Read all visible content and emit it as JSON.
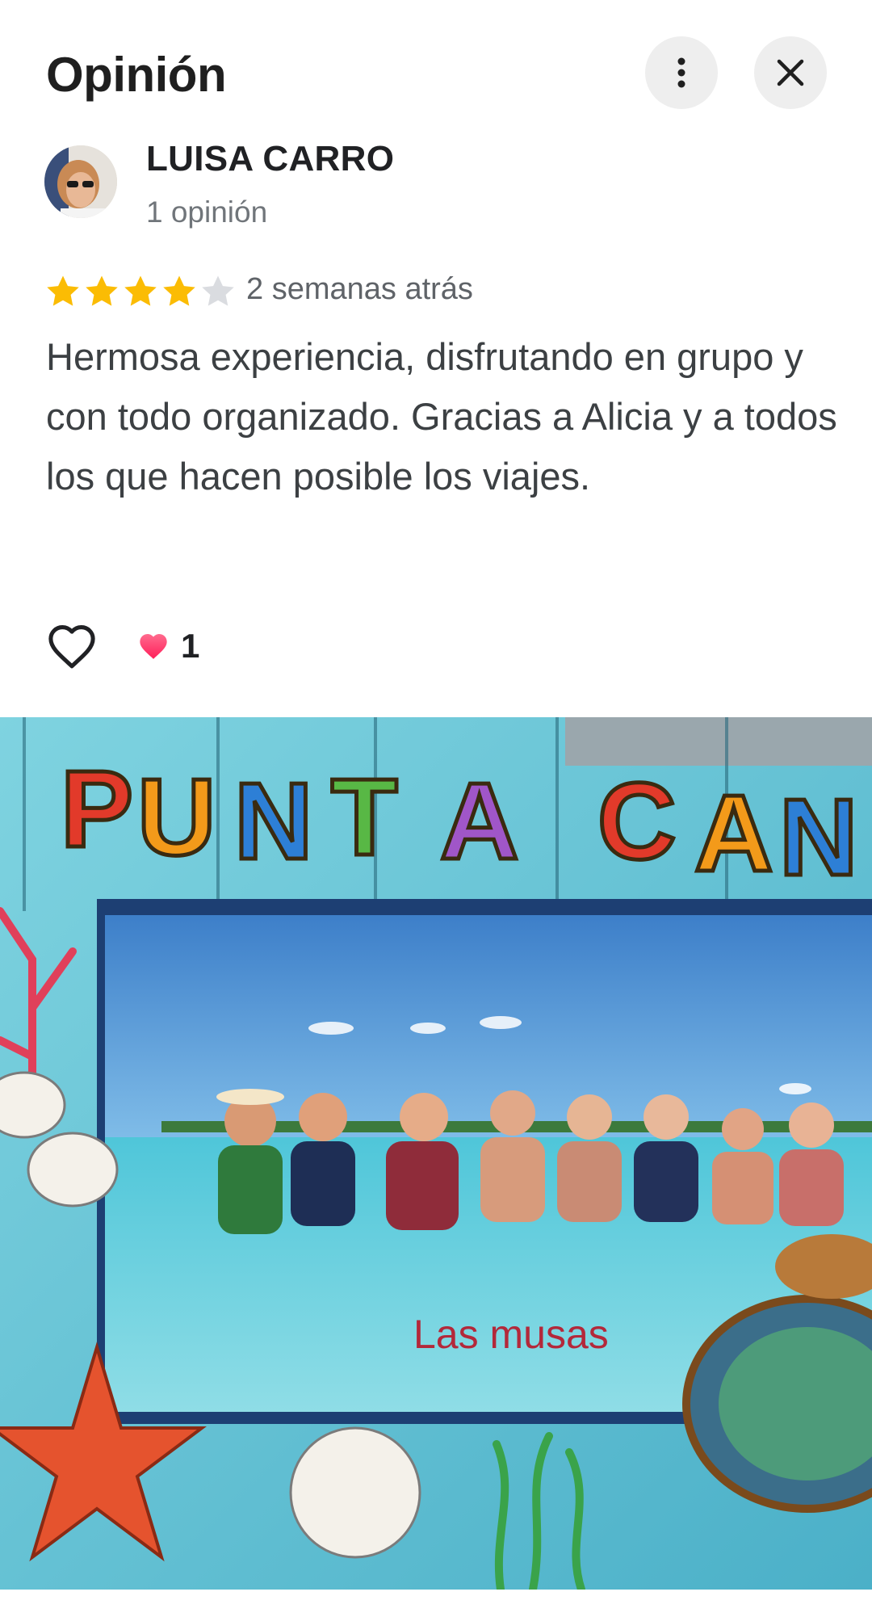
{
  "header": {
    "title": "Opinión",
    "more_icon": "more-vert-icon",
    "close_icon": "close-icon"
  },
  "author": {
    "name": "LUISA CARRO",
    "meta": "1 opinión"
  },
  "review": {
    "rating": 4,
    "rating_max": 5,
    "time_ago": "2 semanas atrás",
    "text": "Hermosa experiencia, disfrutando en grupo y con todo organizado. Gracias a Alicia y a todos los que hacen posible los viajes."
  },
  "actions": {
    "like_icon": "heart-outline-icon",
    "reaction_icon": "heart-icon",
    "reaction_count": "1"
  },
  "photo": {
    "frame_text_left": "PUNTA",
    "frame_text_right": "CAÑA",
    "caption": "Las musas"
  },
  "colors": {
    "star_filled": "#fbbc04",
    "star_empty": "#dadce0",
    "reaction_heart": "#ff3f6e"
  }
}
